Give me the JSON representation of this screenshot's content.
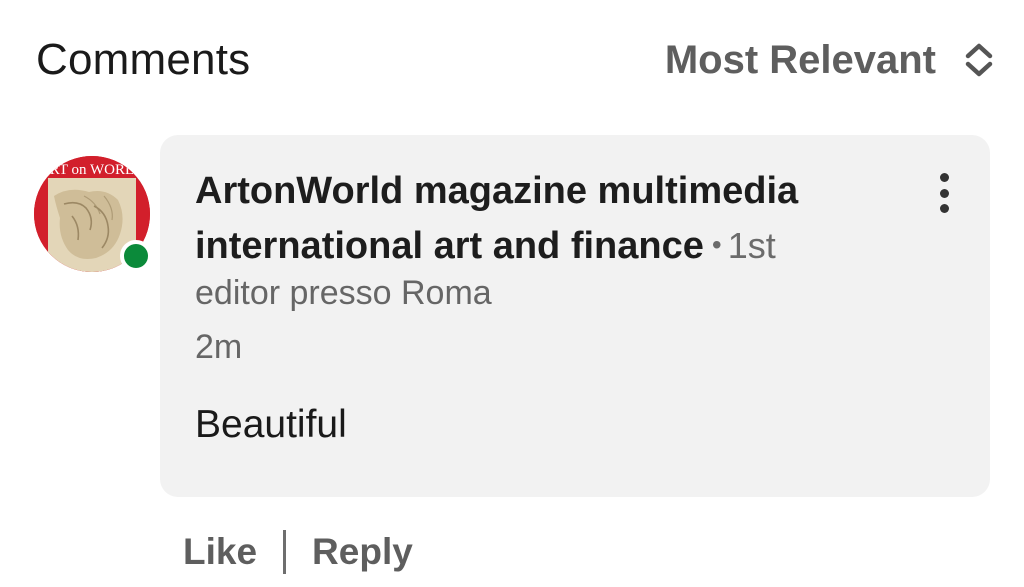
{
  "header": {
    "title": "Comments",
    "sort_label": "Most Relevant",
    "sort_icon": "unfold-icon"
  },
  "comment": {
    "avatar": {
      "banner_text": "ART on WORLD",
      "banner_color": "#d21f2b",
      "online_status_color": "#0b8a3a"
    },
    "author": "ArtonWorld magazine multimedia international art and finance",
    "degree_separator": "•",
    "degree": "1st",
    "headline": "editor presso Roma",
    "timestamp": "2m",
    "text": "Beautiful",
    "menu_icon": "more-vertical-icon"
  },
  "actions": {
    "like_label": "Like",
    "reply_label": "Reply"
  }
}
